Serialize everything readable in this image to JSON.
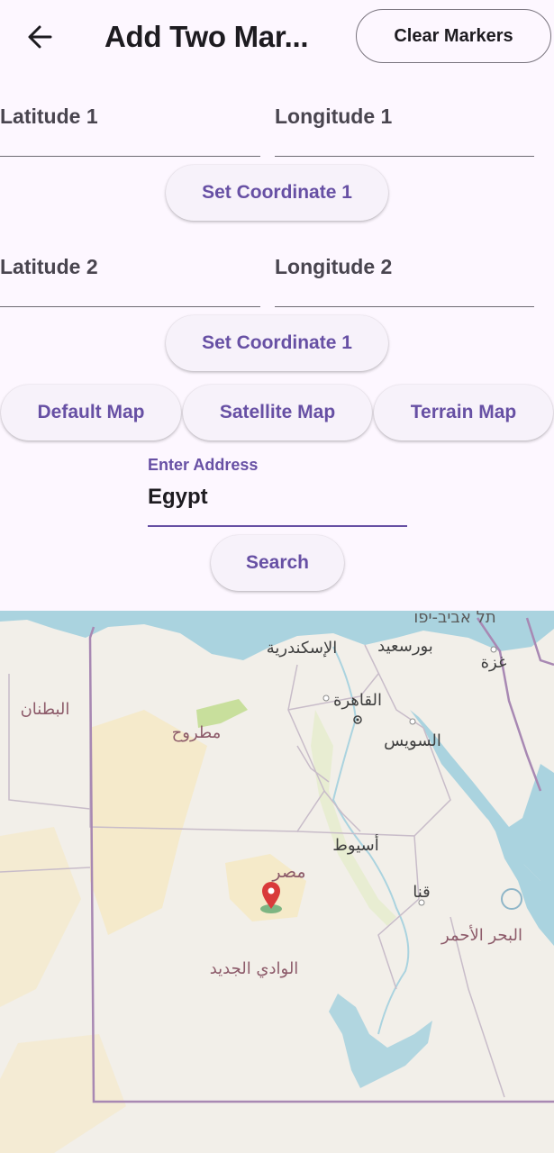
{
  "appbar": {
    "title": "Add Two Mar...",
    "clear_label": "Clear Markers"
  },
  "form": {
    "lat1_label": "Latitude 1",
    "lng1_label": "Longitude 1",
    "set1_label": "Set Coordinate 1",
    "lat2_label": "Latitude 2",
    "lng2_label": "Longitude 2",
    "set2_label": "Set Coordinate 1"
  },
  "map_types": {
    "default_label": "Default Map",
    "satellite_label": "Satellite Map",
    "terrain_label": "Terrain Map"
  },
  "address": {
    "label": "Enter Address",
    "value": "Egypt",
    "search_label": "Search"
  },
  "map": {
    "colors": {
      "land": "#f2efe9",
      "sea": "#aad3df",
      "desert": "#f5e8c0",
      "green": "#c8df9c",
      "border": "#9e7fa8",
      "label": "#8d5b6a",
      "city": "#3f3f3f",
      "marker": "#d93a3a"
    },
    "labels": {
      "telaviv": "תל אביב-יפו",
      "alexandria": "الإسكندرية",
      "portsaid": "بورسعيد",
      "gaza": "غزة",
      "batnan": "البطنان",
      "marsa": "مطروح",
      "cairo": "القاهرة",
      "suez": "السويس",
      "assiut": "أسيوط",
      "egypt": "مصر",
      "qena": "قنا",
      "redsea": "البحر الأحمر",
      "wadi": "الوادي الجديد"
    },
    "marker_icon": "map-pin-icon"
  }
}
